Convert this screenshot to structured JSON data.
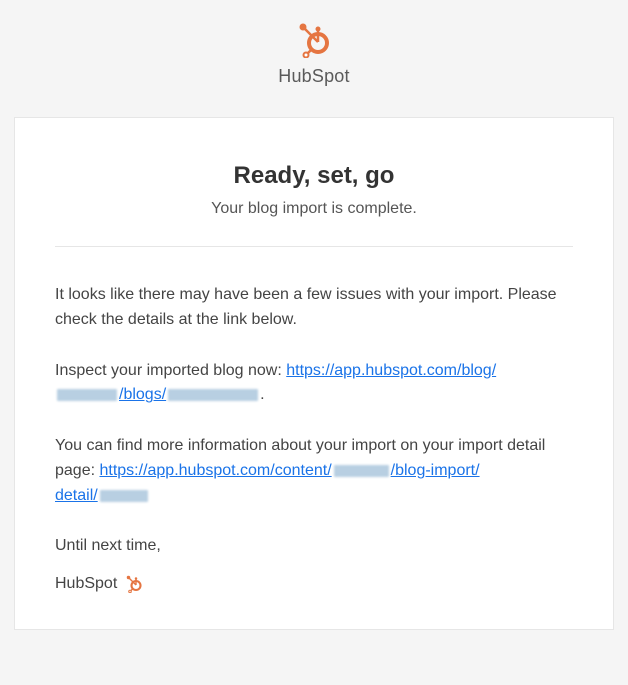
{
  "header": {
    "brand_name": "HubSpot"
  },
  "card": {
    "title": "Ready, set, go",
    "subtitle": "Your blog import is complete.",
    "issues_text": "It looks like there may have been a few issues with your import. Please check the details at the link below.",
    "inspect_prefix": "Inspect your imported blog now: ",
    "inspect_link_part1": "https://app.hubspot.com/blog/",
    "inspect_link_slash_blogs": "/blogs/",
    "inspect_trailing_period": ".",
    "detail_prefix": "You can find more information about your import on your import detail page: ",
    "detail_link_part1": "https://app.hubspot.com/content/",
    "detail_link_blog_import": "/blog-import/",
    "detail_link_detail": "detail/",
    "signoff": "Until next time,",
    "signature": "HubSpot"
  }
}
